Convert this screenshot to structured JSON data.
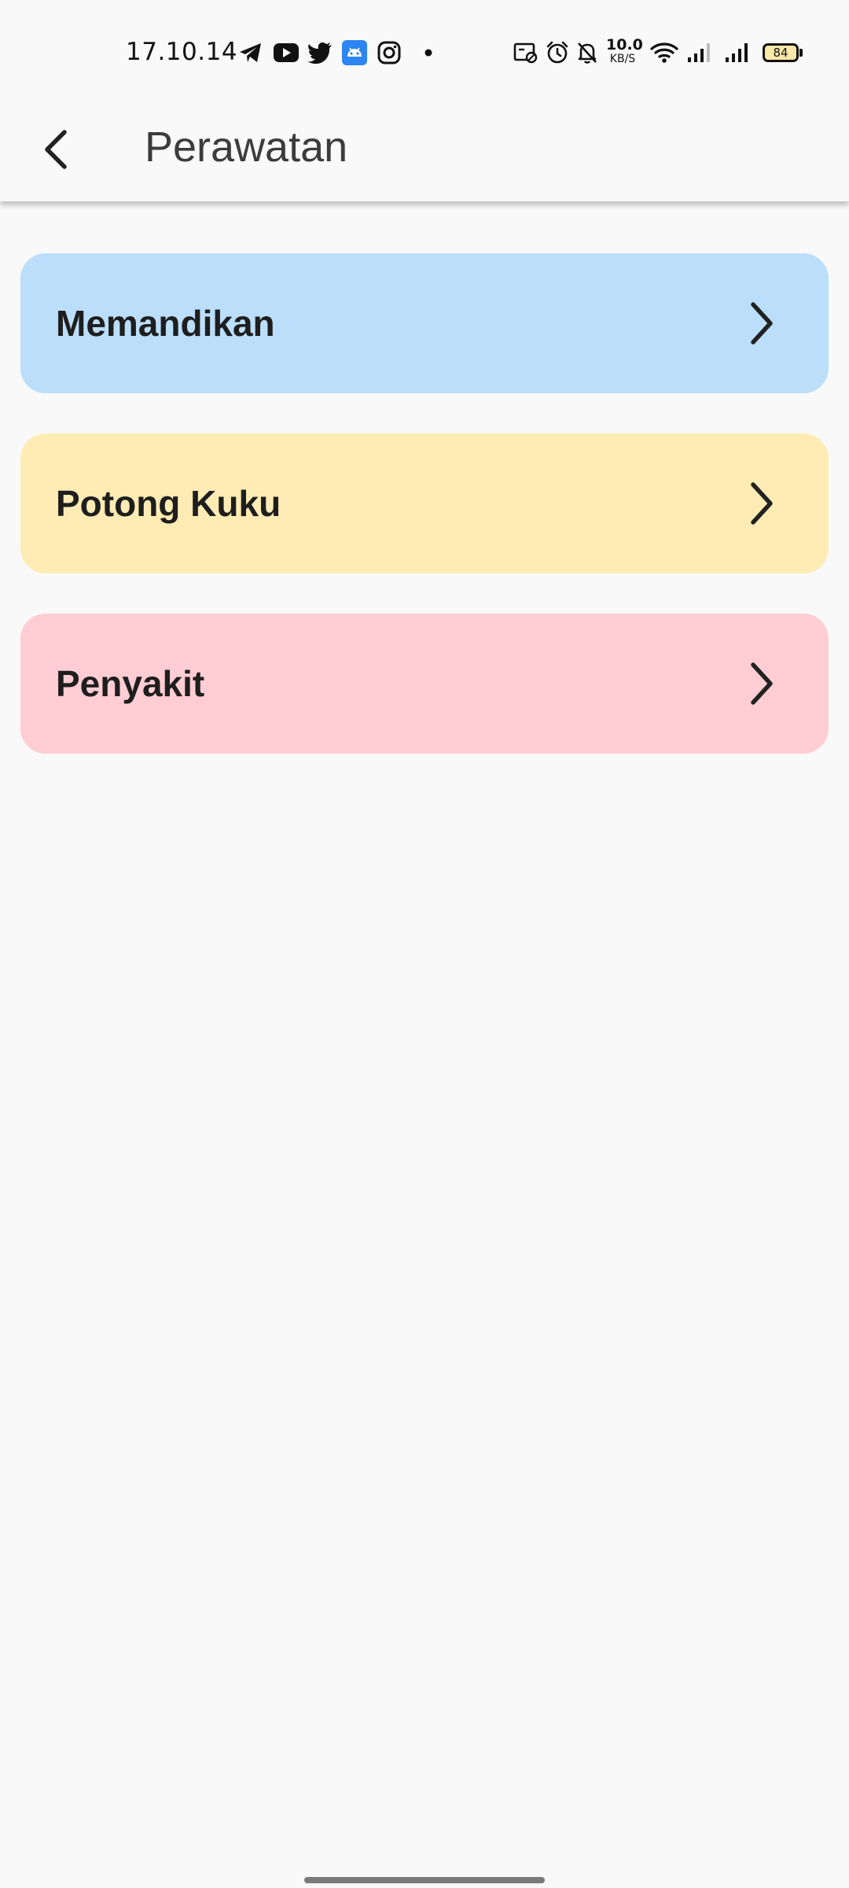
{
  "status_bar": {
    "time": "17.10.14",
    "left_icons": [
      "telegram-icon",
      "youtube-icon",
      "twitter-icon",
      "android-icon",
      "instagram-icon",
      "dot-icon"
    ],
    "right_icons": [
      "screen-record-icon",
      "alarm-icon",
      "bell-off-icon",
      "wifi-icon",
      "signal-icon",
      "signal-icon"
    ],
    "net_speed_value": "10.0",
    "net_speed_unit": "KB/S",
    "battery_level": "84"
  },
  "app_bar": {
    "title": "Perawatan",
    "back_icon": "back-arrow-icon"
  },
  "menu": {
    "items": [
      {
        "label": "Memandikan",
        "color": "#bbdefa",
        "icon": "chevron-right-icon"
      },
      {
        "label": "Potong Kuku",
        "color": "#ffecb4",
        "icon": "chevron-right-icon"
      },
      {
        "label": "Penyakit",
        "color": "#ffcdd3",
        "icon": "chevron-right-icon"
      }
    ]
  },
  "colors": {
    "background": "#f9f9f9",
    "text_primary": "#1e1e1e",
    "title": "#3c3c3c",
    "android_icon_bg": "#2c85f0"
  }
}
